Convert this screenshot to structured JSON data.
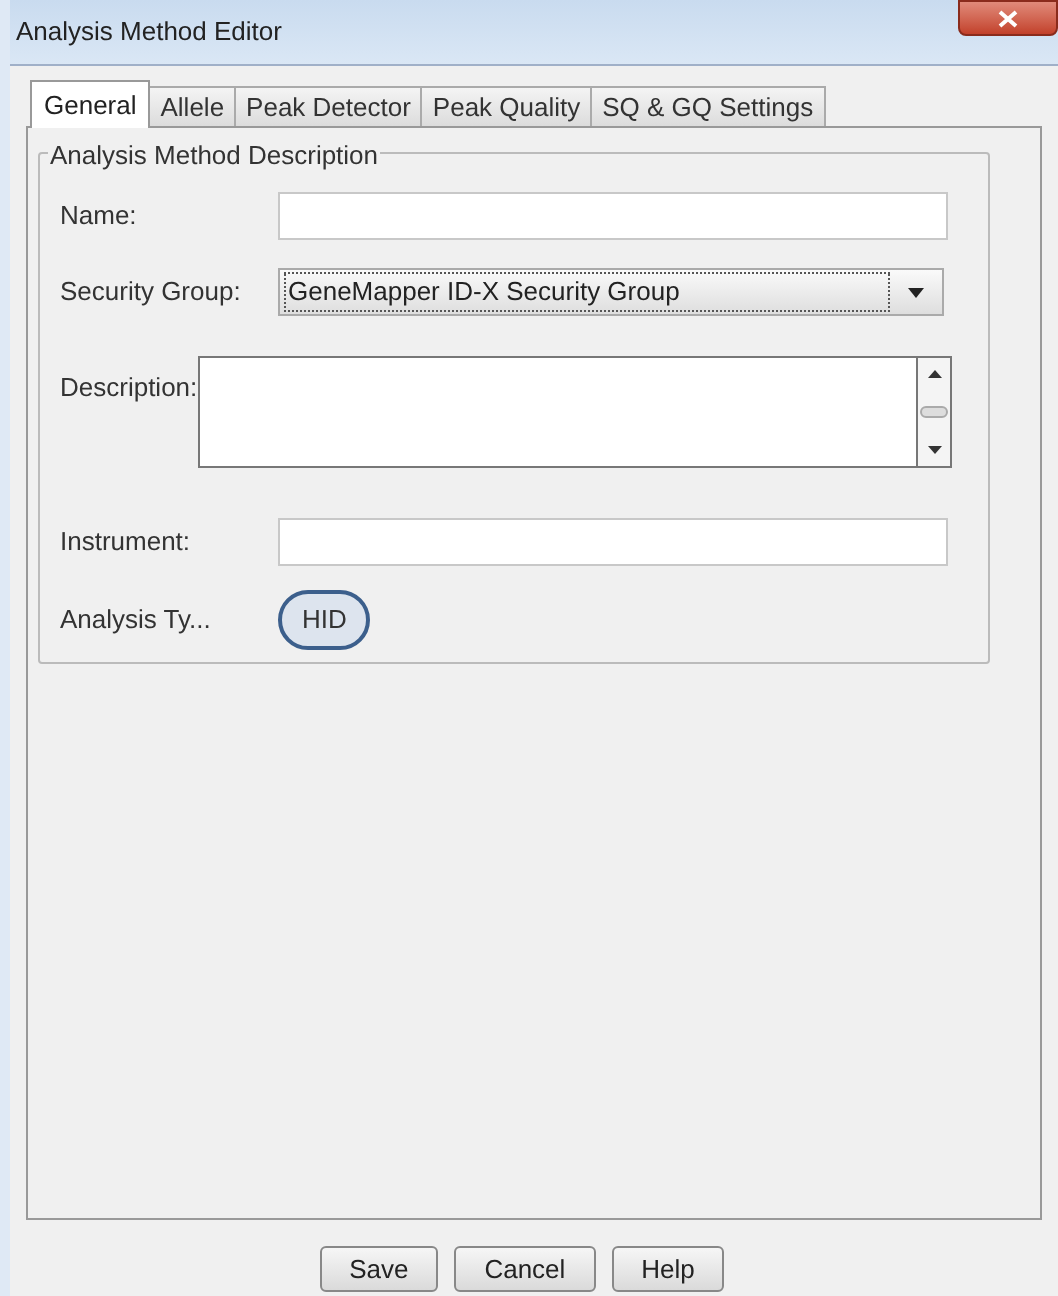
{
  "window": {
    "title": "Analysis Method Editor"
  },
  "tabs": [
    {
      "label": "General",
      "selected": true
    },
    {
      "label": "Allele",
      "selected": false
    },
    {
      "label": "Peak Detector",
      "selected": false
    },
    {
      "label": "Peak Quality",
      "selected": false
    },
    {
      "label": "SQ & GQ Settings",
      "selected": false
    }
  ],
  "group": {
    "title": "Analysis Method Description",
    "fields": [
      {
        "kind": "text",
        "label": "Name:"
      },
      {
        "kind": "select",
        "label": "Security Group:",
        "value": "GeneMapper ID-X Security Group"
      },
      {
        "kind": "textarea",
        "label": "Description:"
      },
      {
        "kind": "text",
        "label": "Instrument:"
      },
      {
        "kind": "static",
        "label": "Analysis Ty...",
        "value": "HID",
        "highlighted": true
      }
    ]
  },
  "buttons": [
    "Save",
    "Cancel",
    "Help"
  ]
}
